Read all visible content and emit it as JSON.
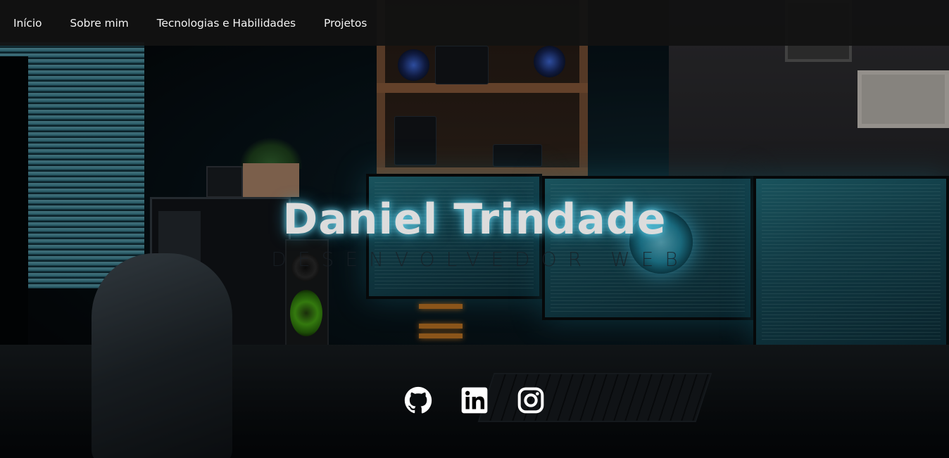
{
  "nav": {
    "items": [
      {
        "label": "Início"
      },
      {
        "label": "Sobre mim"
      },
      {
        "label": "Tecnologias e Habilidades"
      },
      {
        "label": "Projetos"
      }
    ]
  },
  "hero": {
    "name": "Daniel Trindade",
    "subtitle": "DESENVOLVEDOR WEB"
  },
  "social": [
    {
      "icon": "github-icon"
    },
    {
      "icon": "linkedin-icon"
    },
    {
      "icon": "instagram-icon"
    }
  ],
  "colors": {
    "navbar_bg": "#121212",
    "nav_text": "#f3f3f3",
    "title_glow": "#4fd8ff",
    "icon": "#ffffff"
  }
}
